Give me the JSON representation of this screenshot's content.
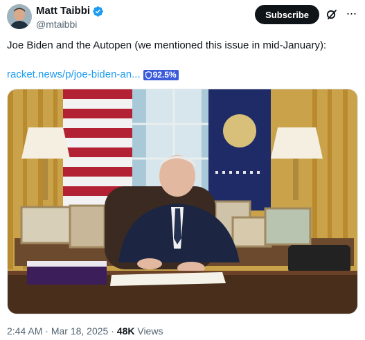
{
  "author": {
    "display_name": "Matt Taibbi",
    "handle": "@mtaibbi",
    "verified_icon": "verified-badge-icon"
  },
  "actions": {
    "subscribe_label": "Subscribe",
    "grok_icon": "grok-icon",
    "more_label": "···"
  },
  "tweet": {
    "text": "Joe Biden and the Autopen (we mentioned this issue in mid-January):",
    "link_text": "racket.news/p/joe-biden-an...",
    "badge_text": "92.5%",
    "badge_icon": "shield-icon"
  },
  "media": {
    "image_icon": "photo-oval-office-signing"
  },
  "meta": {
    "time": "2:44 AM",
    "separator": "·",
    "date": "Mar 18, 2025",
    "views_count": "48K",
    "views_label": "Views"
  },
  "colors": {
    "link": "#1d9bf0",
    "subscribe_bg": "#0f1419",
    "badge_bg": "#3b5bdb",
    "verified": "#1d9bf0"
  }
}
